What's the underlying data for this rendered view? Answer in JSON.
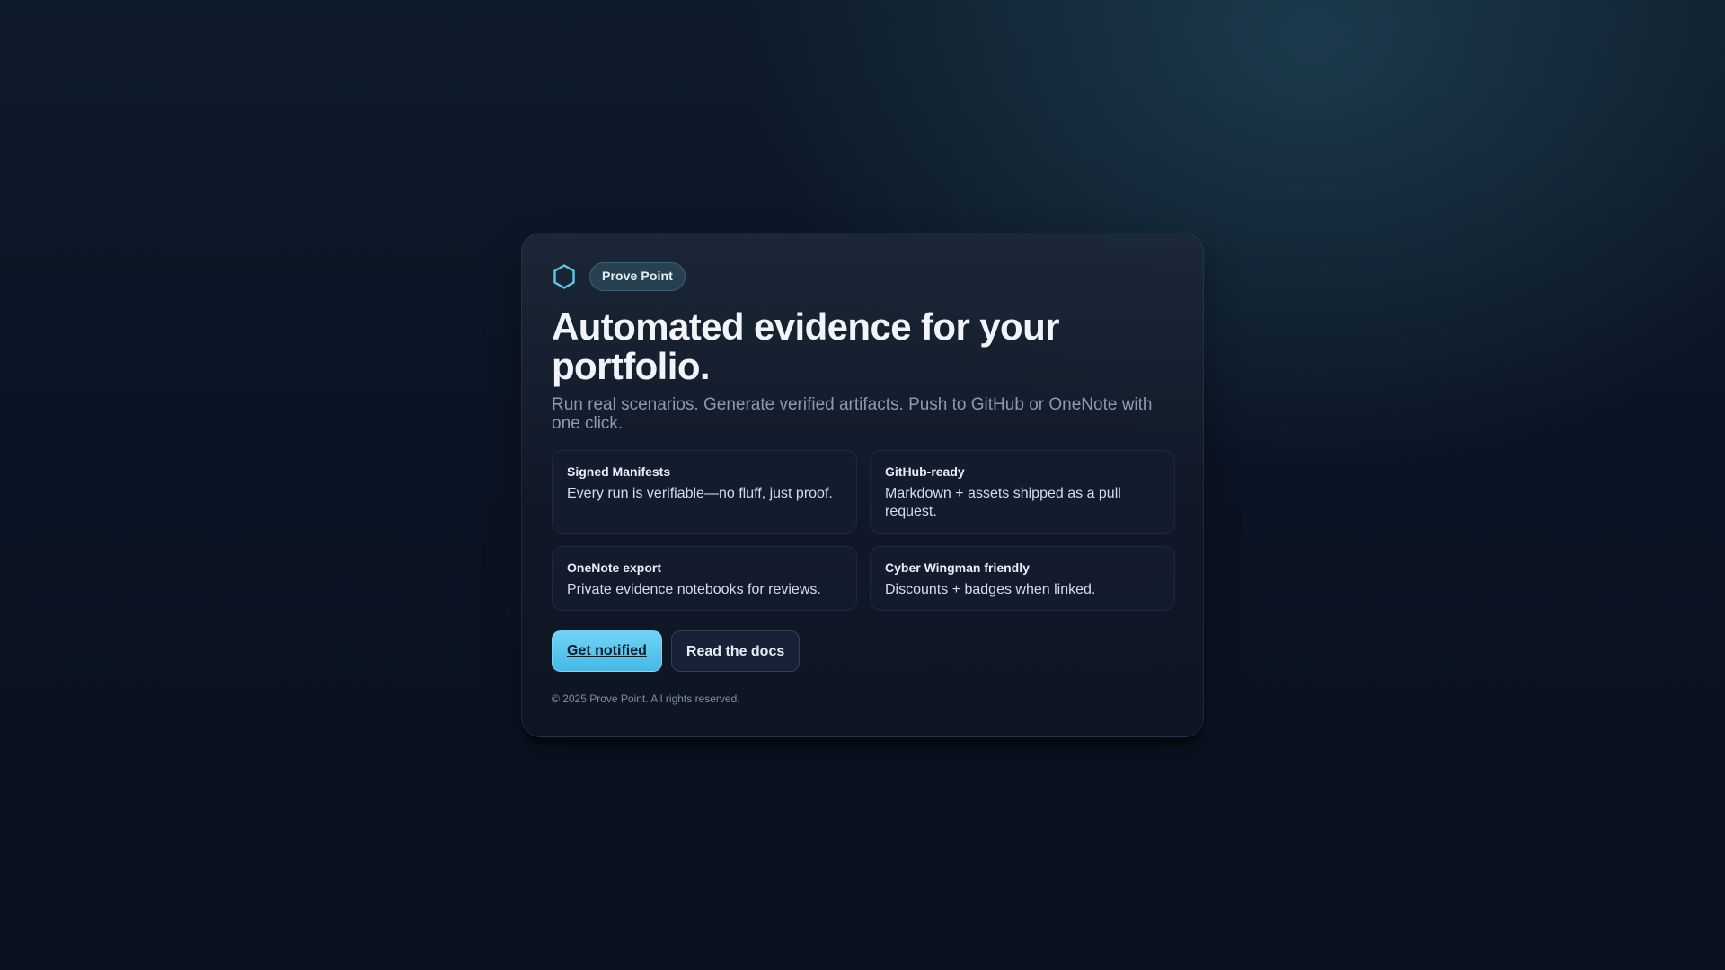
{
  "brand": {
    "icon": "hexagon-icon",
    "name": "Prove Point",
    "accent_color": "#5fc8ea"
  },
  "hero": {
    "headline": "Automated evidence for your portfolio.",
    "subhead": "Run real scenarios. Generate verified artifacts. Push to GitHub or OneNote with one click."
  },
  "features": [
    {
      "title": "Signed Manifests",
      "description": "Every run is verifiable—no fluff, just proof."
    },
    {
      "title": "GitHub-ready",
      "description": "Markdown + assets shipped as a pull request."
    },
    {
      "title": "OneNote export",
      "description": "Private evidence notebooks for reviews."
    },
    {
      "title": "Cyber Wingman friendly",
      "description": "Discounts + badges when linked."
    }
  ],
  "actions": {
    "primary_label": "Get notified",
    "secondary_label": "Read the docs"
  },
  "footer": {
    "copyright": "© 2025 Prove Point. All rights reserved."
  }
}
